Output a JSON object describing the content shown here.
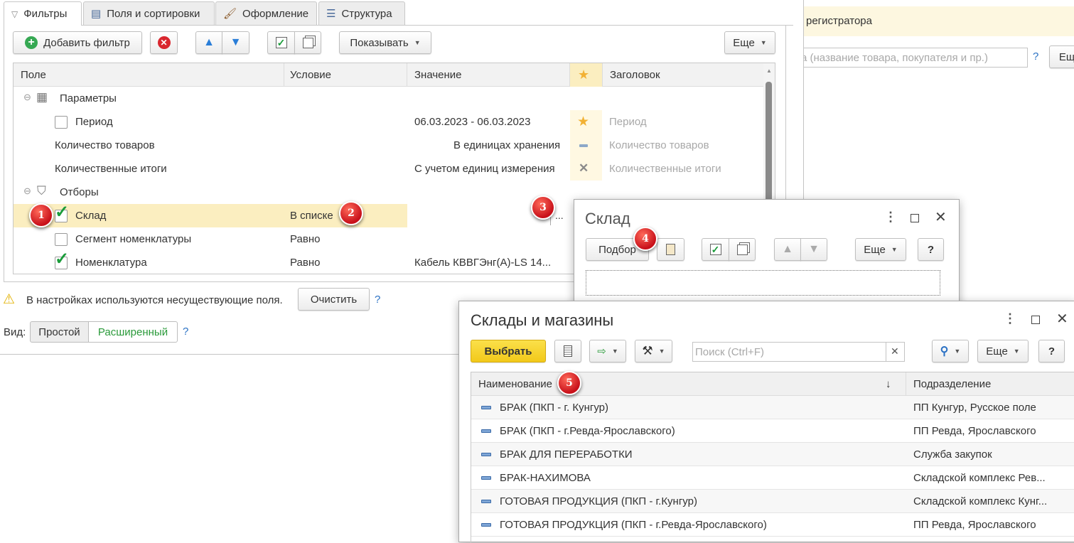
{
  "background": {
    "banner_text": "регистратора",
    "search_placeholder": "а (название товара, покупателя и пр.)",
    "help": "?",
    "more": "Ещ"
  },
  "settings": {
    "tabs": [
      "Фильтры",
      "Поля и сортировки",
      "Оформление",
      "Структура"
    ],
    "toolbar": {
      "add_filter": "Добавить фильтр",
      "show": "Показывать",
      "more": "Еще"
    },
    "columns": [
      "Поле",
      "Условие",
      "Значение",
      "Заголовок"
    ],
    "groups": {
      "params": "Параметры",
      "filters": "Отборы"
    },
    "rows": [
      {
        "field": "Период",
        "condition": "",
        "value": "06.03.2023 - 06.03.2023",
        "title": "Период"
      },
      {
        "field": "Количество товаров",
        "condition": "",
        "value": "В единицах хранения",
        "title": "Количество товаров"
      },
      {
        "field": "Количественные итоги",
        "condition": "",
        "value": "С учетом единиц измерения",
        "title": "Количественные итоги"
      },
      {
        "field": "Склад",
        "condition": "В списке",
        "value": "...",
        "title": ""
      },
      {
        "field": "Сегмент номенклатуры",
        "condition": "Равно",
        "value": "",
        "title": ""
      },
      {
        "field": "Номенклатура",
        "condition": "Равно",
        "value": "Кабель КВВГЭнг(А)-LS 14...",
        "title": ""
      }
    ],
    "warning": "В настройках используются несуществующие поля.",
    "clear": "Очистить",
    "help": "?",
    "view_label": "Вид:",
    "view_simple": "Простой",
    "view_extended": "Расширенный"
  },
  "sklad_dialog": {
    "title": "Склад",
    "pick": "Подбор",
    "more": "Еще",
    "help": "?"
  },
  "stores_dialog": {
    "title": "Склады и магазины",
    "select": "Выбрать",
    "search_placeholder": "Поиск (Ctrl+F)",
    "more": "Еще",
    "help": "?",
    "columns": [
      "Наименование",
      "Подразделение"
    ],
    "sort_arrow": "↓",
    "rows": [
      {
        "name": "БРАК (ПКП - г. Кунгур)",
        "division": "ПП Кунгур, Русское поле"
      },
      {
        "name": "БРАК (ПКП - г.Ревда-Ярославского)",
        "division": "ПП Ревда, Ярославского"
      },
      {
        "name": "БРАК ДЛЯ ПЕРЕРАБОТКИ",
        "division": "Служба закупок"
      },
      {
        "name": "БРАК-НАХИМОВА",
        "division": "Складской комплекс Рев..."
      },
      {
        "name": "ГОТОВАЯ ПРОДУКЦИЯ (ПКП - г.Кунгур)",
        "division": "Складской комплекс Кунг..."
      },
      {
        "name": "ГОТОВАЯ ПРОДУКЦИЯ (ПКП - г.Ревда-Ярославского)",
        "division": "ПП Ревда, Ярославского"
      }
    ]
  },
  "badges": [
    "1",
    "2",
    "3",
    "4",
    "5"
  ],
  "colors": {
    "accent_yellow": "#f6d42b",
    "highlight_row": "#fbeec0",
    "check_green": "#1a9c3a",
    "star": "#f2b134",
    "badge_red": "#d0121c"
  }
}
